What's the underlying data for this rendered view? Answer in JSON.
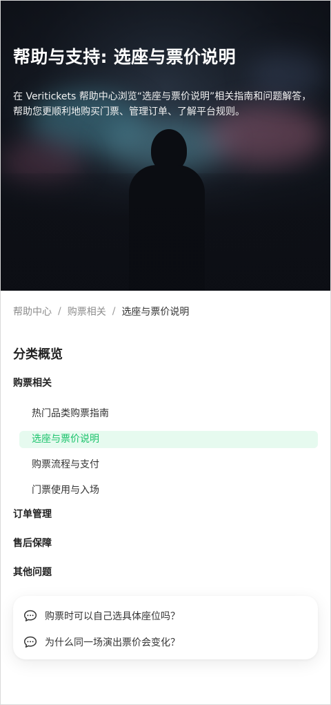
{
  "hero": {
    "title": "帮助与支持: 选座与票价说明",
    "description": "在 Veritickets 帮助中心浏览“选座与票价说明”相关指南和问题解答，帮助您更顺利地购买门票、管理订单、了解平台规则。"
  },
  "breadcrumb": {
    "items": [
      "帮助中心",
      "购票相关",
      "选座与票价说明"
    ],
    "separator": "/"
  },
  "overview": {
    "title": "分类概览",
    "categories": [
      {
        "label": "购票相关",
        "children": [
          "热门品类购票指南",
          "选座与票价说明",
          "购票流程与支付",
          "门票使用与入场"
        ]
      },
      {
        "label": "订单管理"
      },
      {
        "label": "售后保障"
      },
      {
        "label": "其他问题"
      }
    ],
    "active_child": "选座与票价说明"
  },
  "faq": {
    "questions": [
      "购票时可以自己选具体座位吗？",
      "为什么同一场演出票价会变化？"
    ],
    "icon": "chat-bubble-icon"
  },
  "colors": {
    "accent": "#19c26a",
    "active_bg": "#e6faef"
  }
}
